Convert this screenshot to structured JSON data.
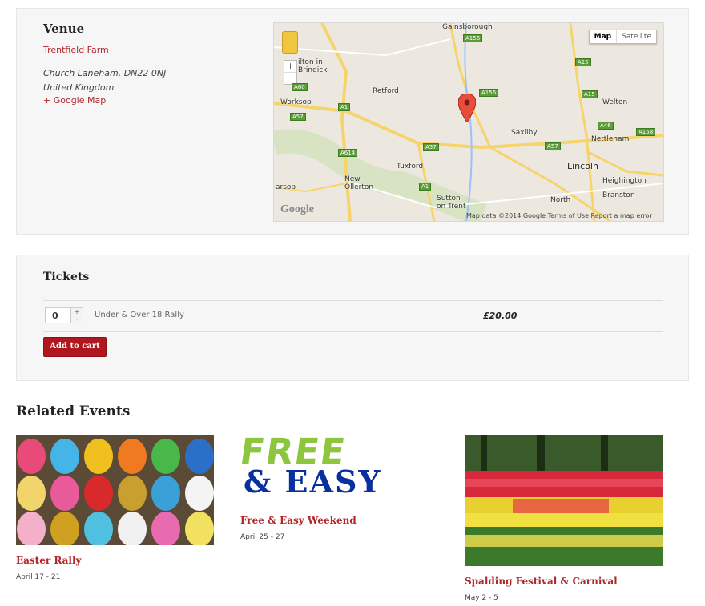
{
  "venue": {
    "heading": "Venue",
    "name": "Trentfield Farm",
    "address": "Church Laneham, DN22 0NJ United Kingdom",
    "map_link": "+ Google Map"
  },
  "map": {
    "type_buttons": [
      "Map",
      "Satellite"
    ],
    "zoom_in": "+",
    "zoom_out": "−",
    "places": [
      "Gainsborough",
      "ilton in Brindick",
      "Worksop",
      "Retford",
      "Welton",
      "Saxilby",
      "Nettleham",
      "Lincoln",
      "Tuxford",
      "New Ollerton",
      "arsop",
      "Sutton on Trent",
      "North",
      "Heighington",
      "Branston"
    ],
    "roads": [
      "A156",
      "A15",
      "A60",
      "A57",
      "A1",
      "A156",
      "A15",
      "A46",
      "A158",
      "A614",
      "A57",
      "A57",
      "A1"
    ],
    "logo": "Google",
    "attribution": "Map data ©2014 Google   Terms of Use   Report a map error"
  },
  "tickets": {
    "heading": "Tickets",
    "quantity": "0",
    "step_up": "+",
    "step_down": "-",
    "ticket_name": "Under & Over 18 Rally",
    "price": "£20.00",
    "add_to_cart": "Add to cart"
  },
  "related": {
    "heading": "Related Events",
    "events": [
      {
        "title": "Easter Rally",
        "date": "April 17 - 21"
      },
      {
        "title": "Free & Easy Weekend",
        "date": "April 25 - 27",
        "image_text": [
          "FREE",
          "& EASY"
        ]
      },
      {
        "title": "Spalding Festival & Carnival",
        "date": "May 2 - 5"
      }
    ]
  },
  "colors": {
    "accent": "#b0262b",
    "button": "#b0161e",
    "free_green": "#8cc63f",
    "easy_blue": "#0a2f9e"
  }
}
